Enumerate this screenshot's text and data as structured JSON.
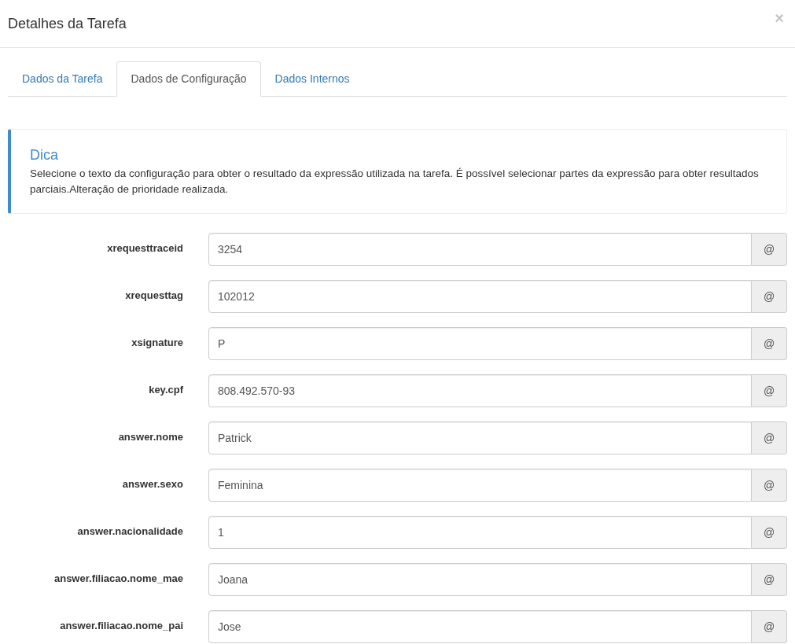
{
  "modal": {
    "title": "Detalhes da Tarefa",
    "close": "×"
  },
  "tabs": [
    {
      "label": "Dados da Tarefa",
      "selected": false
    },
    {
      "label": "Dados de Configuração",
      "selected": true
    },
    {
      "label": "Dados Internos",
      "selected": false
    }
  ],
  "callout": {
    "title": "Dica",
    "text": "Selecione o texto da configuração para obter o resultado da expressão utilizada na tarefa. É possível selecionar partes da expressão para obter resultados parciais.Alteração de prioridade realizada."
  },
  "fields": [
    {
      "label": "xrequesttraceid",
      "value": "3254",
      "addon": "@"
    },
    {
      "label": "xrequesttag",
      "value": "102012",
      "addon": "@"
    },
    {
      "label": "xsignature",
      "value": "P",
      "addon": "@"
    },
    {
      "label": "key.cpf",
      "value": "808.492.570-93",
      "addon": "@"
    },
    {
      "label": "answer.nome",
      "value": "Patrick",
      "addon": "@"
    },
    {
      "label": "answer.sexo",
      "value": "Feminina",
      "addon": "@"
    },
    {
      "label": "answer.nacionalidade",
      "value": "1",
      "addon": "@"
    },
    {
      "label": "answer.filiacao.nome_mae",
      "value": "Joana",
      "addon": "@"
    },
    {
      "label": "answer.filiacao.nome_pai",
      "value": "Jose",
      "addon": "@"
    }
  ]
}
